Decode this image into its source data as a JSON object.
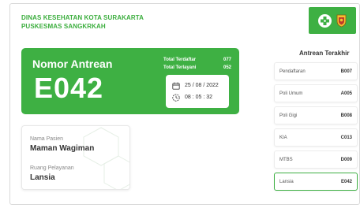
{
  "header": {
    "line1": "DINAS KESEHATAN KOTA SURAKARTA",
    "line2": "PUSKESMAS SANGKRKAH"
  },
  "queue": {
    "label": "Nomor Antrean",
    "number": "E042",
    "total_registered_label": "Total Terdaftar",
    "total_registered_value": "077",
    "total_served_label": "Total Terlayani",
    "total_served_value": "052",
    "date": "25 / 08 / 2022",
    "time": "08 : 05 : 32"
  },
  "patient": {
    "name_label": "Nama Pasien",
    "name": "Maman Wagiman",
    "room_label": "Ruang Pelayanan",
    "room": "Lansia"
  },
  "recent": {
    "title": "Antrean Terakhir",
    "items": [
      {
        "service": "Pendaftaran",
        "number": "B007"
      },
      {
        "service": "Poli Umum",
        "number": "A005"
      },
      {
        "service": "Poli Gigi",
        "number": "B008"
      },
      {
        "service": "KIA",
        "number": "C013"
      },
      {
        "service": "MTBS",
        "number": "D009"
      },
      {
        "service": "Lansia",
        "number": "E042"
      }
    ]
  },
  "colors": {
    "accent": "#3eb043",
    "accent_text": "#3cae3e"
  },
  "icons": [
    "health-logo-icon",
    "city-emblem-icon",
    "calendar-icon",
    "clock-icon"
  ]
}
